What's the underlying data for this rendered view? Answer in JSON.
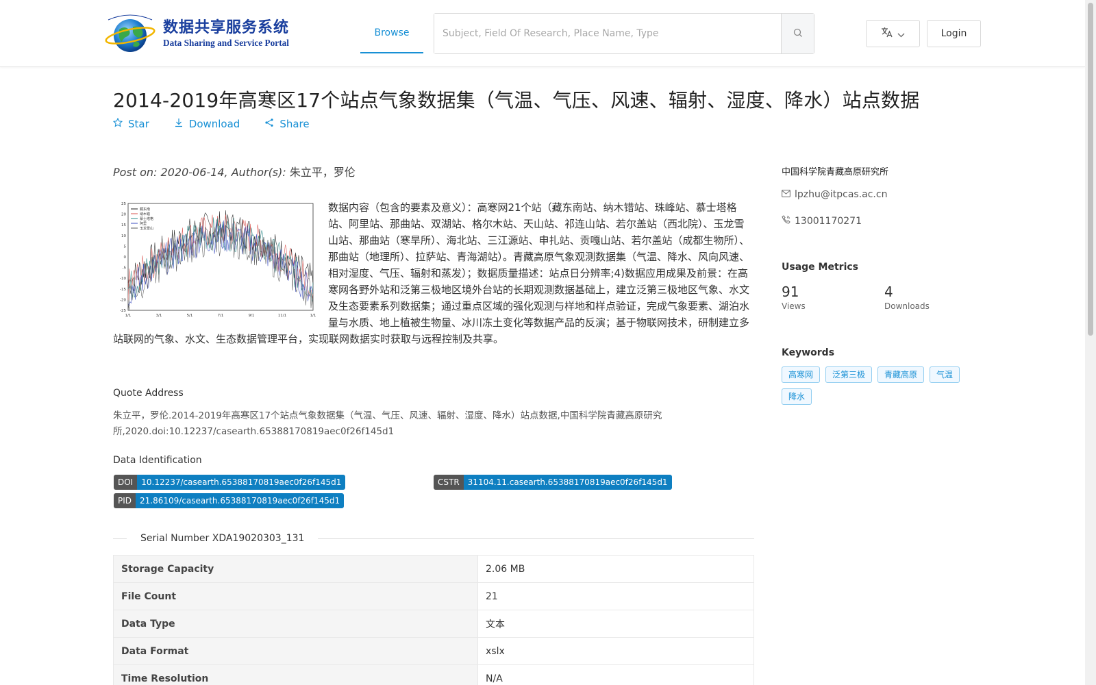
{
  "header": {
    "logo_cn": "数据共享服务系统",
    "logo_en": "Data Sharing and Service Portal",
    "nav_browse": "Browse",
    "search_placeholder": "Subject, Field Of Research, Place Name, Type",
    "login": "Login"
  },
  "dataset": {
    "title": "2014-2019年高寒区17个站点气象数据集（气温、气压、风速、辐射、湿度、降水）站点数据",
    "actions": {
      "star": "Star",
      "download": "Download",
      "share": "Share"
    },
    "post_prefix": "Post on: 2020-06-14, Author(s): ",
    "authors": "朱立平，罗伦",
    "description": "数据内容（包含的要素及意义）：高寒网21个站（藏东南站、纳木错站、珠峰站、慕士塔格站、阿里站、那曲站、双湖站、格尔木站、天山站、祁连山站、若尔盖站（西北院）、玉龙雪山站、那曲站（寒旱所）、海北站、三江源站、申扎站、贡嘎山站、若尔盖站（成都生物所）、那曲站（地理所）、拉萨站、青海湖站）。青藏高原气象观测数据集（气温、降水、风向风速、相对湿度、气压、辐射和蒸发）；数据质量描述：站点日分辨率;4)数据应用成果及前景：在高寒网各野外站和泛第三极地区境外台站的长期观测数据基础上，建立泛第三极地区气象、水文及生态要素系列数据集；通过重点区域的强化观测与样地和样点验证，完成气象要素、湖泊水量与水质、地上植被生物量、冰川冻土变化等数据产品的反演；基于物联网技术，研制建立多站联网的气象、水文、生态数据管理平台，实现联网数据实时获取与远程控制及共享。",
    "quote_label": "Quote Address",
    "quote_text": "朱立平，罗伦.2014-2019年高寒区17个站点气象数据集（气温、气压、风速、辐射、湿度、降水）站点数据,中国科学院青藏高原研究所,2020.doi:10.12237/casearth.65388170819aec0f26f145d1",
    "identification_label": "Data Identification",
    "doi_key": "DOI",
    "doi_value": "10.12237/casearth.65388170819aec0f26f145d1",
    "cstr_key": "CSTR",
    "cstr_value": "31104.11.casearth.65388170819aec0f26f145d1",
    "pid_key": "PID",
    "pid_value": "21.86109/casearth.65388170819aec0f26f145d1",
    "serial_number": "Serial Number XDA19020303_131",
    "info_rows": [
      {
        "key": "Storage Capacity",
        "value": "2.06 MB"
      },
      {
        "key": "File Count",
        "value": "21"
      },
      {
        "key": "Data Type",
        "value": "文本"
      },
      {
        "key": "Data Format",
        "value": "xslx"
      },
      {
        "key": "Time Resolution",
        "value": "N/A"
      }
    ]
  },
  "sidebar": {
    "org": "中国科学院青藏高原研究所",
    "email": "lpzhu@itpcas.ac.cn",
    "phone": "13001170271",
    "usage_title": "Usage Metrics",
    "views_num": "91",
    "views_label": "Views",
    "downloads_num": "4",
    "downloads_label": "Downloads",
    "keywords_title": "Keywords",
    "keywords": [
      "高寒网",
      "泛第三极",
      "青藏高原",
      "气温",
      "降水"
    ]
  },
  "thumbnail": {
    "legend": [
      "藏东南",
      "纳木错",
      "慕士塔格",
      "阿里",
      "玉龙雪山"
    ],
    "y_ticks": [
      "25",
      "20",
      "15",
      "10",
      "5",
      "0",
      "-5",
      "-10",
      "-15",
      "-20",
      "-25"
    ],
    "x_ticks": [
      "1/1",
      "3/1",
      "5/1",
      "7/1",
      "9/1",
      "11/1",
      "1/1"
    ],
    "series_colors": [
      "#1a1a1a",
      "#d9534f",
      "#2b8a8a",
      "#3b4cc0",
      "#555555"
    ]
  }
}
